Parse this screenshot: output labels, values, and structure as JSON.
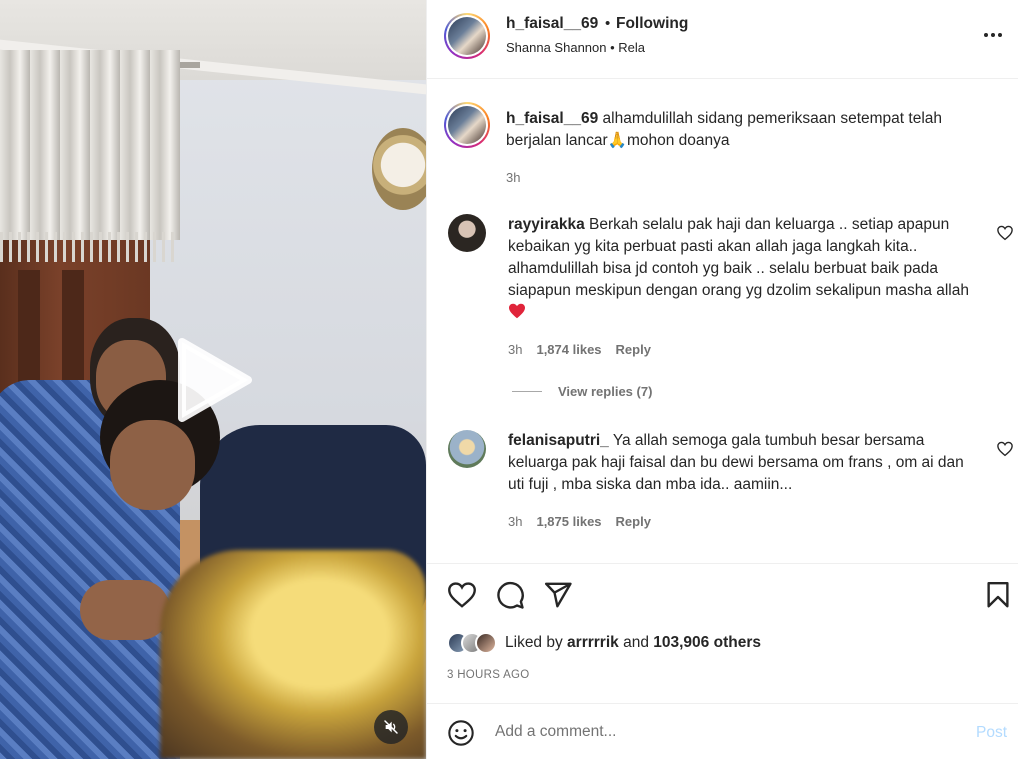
{
  "post": {
    "owner_username": "h_faisal__69",
    "separator": "•",
    "follow_status": "Following",
    "audio_line": "Shanna Shannon • Rela",
    "caption_text": "alhamdulillah sidang pemeriksaan setempat telah berjalan lancar🙏mohon doanya",
    "caption_time": "3h"
  },
  "comments": [
    {
      "username": "rayyirakka",
      "text": "Berkah selalu pak haji dan keluarga .. setiap apapun kebaikan yg kita perbuat pasti akan allah jaga langkah kita.. alhamdulillah bisa jd contoh yg baik .. selalu berbuat baik pada siapapun meskipun dengan orang yg dzolim sekalipun masha allah",
      "time": "3h",
      "likes": "1,874 likes",
      "reply_label": "Reply"
    },
    {
      "username": "felanisaputri_",
      "text": "Ya allah semoga gala tumbuh besar bersama keluarga pak haji faisal dan bu dewi bersama om frans , om ai dan uti fuji , mba siska dan mba ida.. aamiin...",
      "time": "3h",
      "likes": "1,875 likes",
      "reply_label": "Reply"
    }
  ],
  "view_replies_label": "View replies (7)",
  "likes": {
    "prefix": "Liked by",
    "first_user": "arrrrrik",
    "joiner": "and",
    "others": "103,906 others"
  },
  "post_time": "3 HOURS AGO",
  "comment_box": {
    "placeholder": "Add a comment...",
    "post_label": "Post"
  },
  "colors": {
    "like_heart": "#ed4956",
    "post_button_disabled": "#b3dbff",
    "secondary_text": "#737373"
  },
  "icons": [
    "play-icon",
    "mute-icon",
    "more-icon",
    "heart-icon",
    "comment-icon",
    "share-icon",
    "bookmark-icon",
    "emoji-icon"
  ]
}
